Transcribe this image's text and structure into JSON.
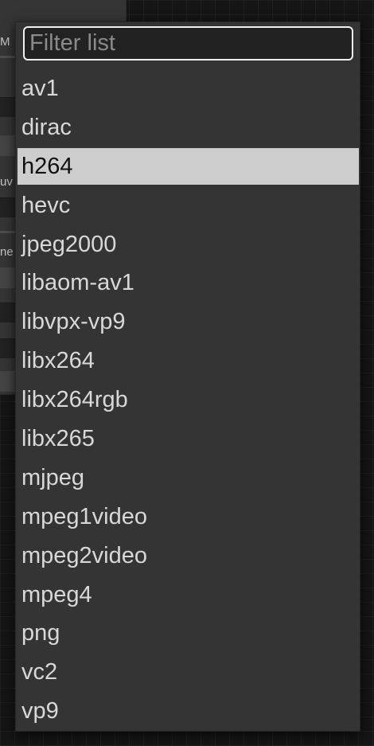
{
  "background_node": {
    "fragments": [
      "M",
      "uv",
      "ne"
    ]
  },
  "dropdown": {
    "filter": {
      "placeholder": "Filter list",
      "value": ""
    },
    "selected_index": 2,
    "items": [
      "av1",
      "dirac",
      "h264",
      "hevc",
      "jpeg2000",
      "libaom-av1",
      "libvpx-vp9",
      "libx264",
      "libx264rgb",
      "libx265",
      "mjpeg",
      "mpeg1video",
      "mpeg2video",
      "mpeg4",
      "png",
      "vc2",
      "vp9"
    ]
  },
  "colors": {
    "canvas": "#151515",
    "popup_bg": "#343434",
    "item_text": "#d8d8d8",
    "selected_bg": "#cdcdcd",
    "selected_text": "#111111",
    "filter_border": "#f0f0f0"
  }
}
